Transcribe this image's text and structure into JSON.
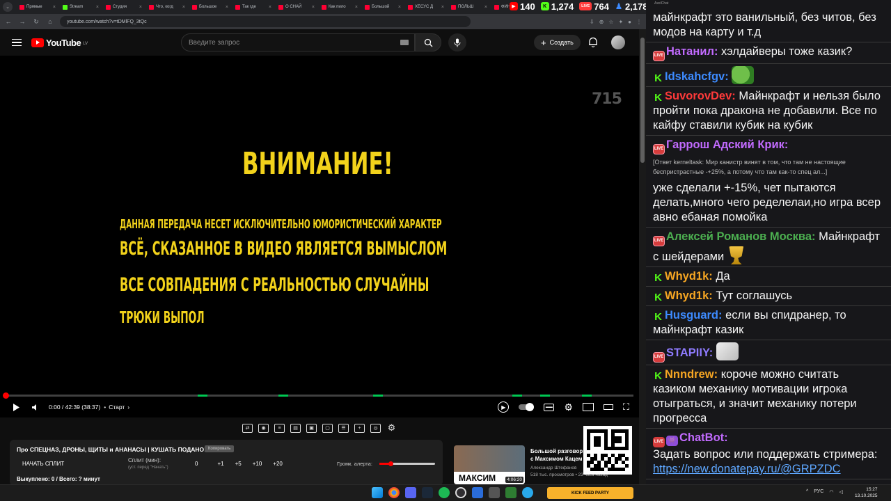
{
  "browser": {
    "tabs": [
      {
        "label": "Прямые",
        "icon": "youtube-icon"
      },
      {
        "label": "Stream",
        "icon": "kick-icon"
      },
      {
        "label": "Студия",
        "icon": "youtube-icon"
      },
      {
        "label": "Что, когд",
        "icon": "youtube-icon"
      },
      {
        "label": "Большое",
        "icon": "youtube-icon"
      },
      {
        "label": "Так где",
        "icon": "youtube-icon"
      },
      {
        "label": "О СНАЙ",
        "icon": "youtube-icon"
      },
      {
        "label": "Как пило",
        "icon": "youtube-icon"
      },
      {
        "label": "Большой",
        "icon": "youtube-icon"
      },
      {
        "label": "ХЕСУС Д",
        "icon": "youtube-icon"
      },
      {
        "label": "ПОЛЬШ",
        "icon": "youtube-icon"
      },
      {
        "label": "ФИНАЛ",
        "icon": "youtube-icon"
      }
    ],
    "url": "youtube.com/watch?v=tDMlFQ_3tQc"
  },
  "stream_stats": [
    {
      "icon": "youtube-live-icon",
      "value": "140",
      "color": "#ff0000"
    },
    {
      "icon": "kick-icon",
      "value": "1,274",
      "color": "#53fc18"
    },
    {
      "icon": "vk-live-icon",
      "value": "764",
      "color": "#ff3b3b"
    },
    {
      "icon": "viewers-icon",
      "value": "2,178",
      "color": "#3d8bff"
    }
  ],
  "youtube": {
    "logo_text": "YouTube",
    "country_code": "LV",
    "search_placeholder": "Введите запрос",
    "create_label": "Создать"
  },
  "video": {
    "watermark": "715",
    "title": "ВНИМАНИЕ!",
    "line1": "Данная передача несет исключительно юмористический характер",
    "line2": "Всё, сказанное в видео является вымыслом",
    "line3": "Все совпадения с реальностью случайны",
    "line4": "Трюки выпол",
    "time": "0:00 / 42:39 (38:37)",
    "chapter": "Старт",
    "progress": 0
  },
  "panel": {
    "title": "Про СПЕЦНАЗ, ДРОНЫ, ЩИТЫ и АНАНАСЫ | КУШАТЬ ПОДАНО!",
    "copy_label": "Копировать",
    "split_button": "НАЧАТЬ СПЛИТ",
    "split_min_label": "Сплит (мин):",
    "split_hint": "(уст. перед \"Начать\")",
    "split_values": [
      "0",
      "+1",
      "+5",
      "+10",
      "+20"
    ],
    "volume_label": "Громк. алерта:",
    "volume_level": 0.2,
    "bought": "Выкуплено: 0 / Всего: ? минут"
  },
  "recommended": {
    "title": "Большой разговор с Максимом Кацем",
    "thumb_text": "МАКСИМ",
    "duration": "4:06:20",
    "channel": "Александр Штефанов",
    "meta": "518 тыс. просмотров • 23 часа назад"
  },
  "chat": {
    "header": "AxelChat",
    "messages": [
      {
        "platform": "",
        "user": "",
        "user_color": "#fff",
        "text": "майнкрафт это ванильный, без читов, без модов на карту и т.д"
      },
      {
        "platform": "yt",
        "user": "Натанил:",
        "user_color": "#c26bff",
        "text": "хэлдайверы тоже казик?"
      },
      {
        "platform": "kick",
        "user": "Idskahcfgv:",
        "user_color": "#3d8bff",
        "text": "",
        "emote": "pepe"
      },
      {
        "platform": "kick",
        "user": "SuvorovDev:",
        "user_color": "#ff3a3a",
        "text": "Майнкрафт и нельзя было пройти пока дракона не добавили. Все по кайфу ставили кубик на кубик"
      },
      {
        "platform": "yt",
        "user": "Гаррош Адский Крик:",
        "user_color": "#c26bff",
        "reply": "[Ответ kerneltask: Мир канистр винят в том, что там не настоящие беспристрастные -+25%, а потому что там как-то спец ал...]",
        "text": "уже сделали +-15%, чет пытаются делать,много чего ределелаи,но игра всер авно ебаная помойка"
      },
      {
        "platform": "yt",
        "user": "Алексей Романов Москва:",
        "user_color": "#4caf50",
        "text": "Майнкрафт с шейдерами",
        "emote": "trophy"
      },
      {
        "platform": "kick",
        "user": "Whyd1k:",
        "user_color": "#f6a623",
        "text": "Да"
      },
      {
        "platform": "kick",
        "user": "Whyd1k:",
        "user_color": "#f6a623",
        "text": "Тут соглашусь"
      },
      {
        "platform": "kick",
        "user": "Husguard:",
        "user_color": "#3d8bff",
        "text": "если вы спидранер, то майнкрафт казик"
      },
      {
        "platform": "yt",
        "user": "STAPIIY:",
        "user_color": "#8f7bff",
        "text": "",
        "emote": "cat"
      },
      {
        "platform": "kick",
        "user": "Nnndrew:",
        "user_color": "#f6a623",
        "text": "короче можно считать казиком механику мотивации игрока отыграться, и значит механику потери прогресса"
      },
      {
        "platform": "bot",
        "user": "ChatBot:",
        "user_color": "#c26bff",
        "text": "Задать вопрос или поддержать стримера:",
        "link": "https://new.donatepay.ru/@GRPZDC"
      }
    ]
  },
  "taskbar": {
    "kick_label": "KICK FEED PARTY",
    "lang": "РУС",
    "time": "15:27",
    "date": "13.10.2025"
  }
}
